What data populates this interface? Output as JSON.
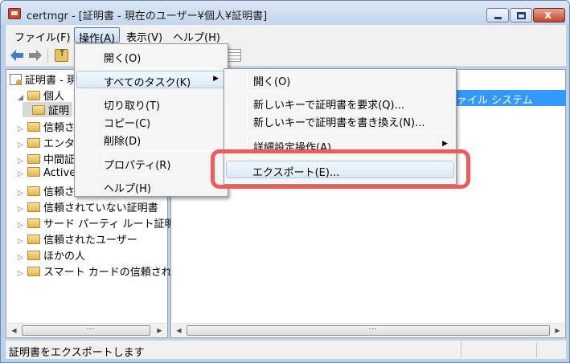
{
  "window": {
    "title": "certmgr - [証明書 - 現在のユーザー¥個人¥証明書]",
    "close_glyph": "x"
  },
  "menubar": {
    "items": [
      "ファイル(F)",
      "操作(A)",
      "表示(V)",
      "ヘルプ(H)"
    ],
    "active_index": 1
  },
  "toolbar": {
    "icons": [
      "back-arrow-icon",
      "forward-arrow-icon",
      "up-folder-icon",
      "list-view-icon"
    ]
  },
  "tree": {
    "root": "証明書 - 現",
    "items": [
      {
        "label": "個人",
        "expander": "◢"
      },
      {
        "label": "証明",
        "expander": ""
      },
      {
        "label": "信頼され",
        "expander": "▷"
      },
      {
        "label": "エンター",
        "expander": "▷"
      },
      {
        "label": "中間証明",
        "expander": "▷"
      },
      {
        "label": "Active",
        "expander": "▷"
      },
      {
        "label": "信頼され",
        "expander": "▷"
      },
      {
        "label": "信頼されていない証明書",
        "expander": "▷"
      },
      {
        "label": "サード パーティ ルート証明",
        "expander": "▷"
      },
      {
        "label": "信頼されたユーザー",
        "expander": "▷"
      },
      {
        "label": "ほかの人",
        "expander": "▷"
      },
      {
        "label": "スマート カードの信頼され",
        "expander": "▷"
      }
    ]
  },
  "right_pane": {
    "selected_text": "ァイル システム"
  },
  "action_menu": {
    "items": [
      {
        "label": "開く(O)",
        "submenu": false
      },
      {
        "label": "すべてのタスク(K)",
        "submenu": true,
        "hot": true
      },
      {
        "label": "切り取り(T)",
        "submenu": false
      },
      {
        "label": "コピー(C)",
        "submenu": false
      },
      {
        "label": "削除(D)",
        "submenu": false
      },
      {
        "label": "プロパティ(R)",
        "submenu": false
      },
      {
        "label": "ヘルプ(H)",
        "submenu": false
      }
    ],
    "submenu_arrow": "▶"
  },
  "tasks_submenu": {
    "items": [
      {
        "label": "開く(O)",
        "submenu": false
      },
      {
        "label": "新しいキーで証明書を要求(Q)...",
        "submenu": false
      },
      {
        "label": "新しいキーで証明書を書き換え(N)...",
        "submenu": false
      },
      {
        "label": "詳細設定操作(A)",
        "submenu": true
      },
      {
        "label": "エクスポート(E)...",
        "submenu": false,
        "hot": true
      }
    ]
  },
  "statusbar": {
    "text": "証明書をエクスポートします"
  },
  "accent": {
    "selection": "#3399ff",
    "highlight_ring": "#f05a5a"
  }
}
